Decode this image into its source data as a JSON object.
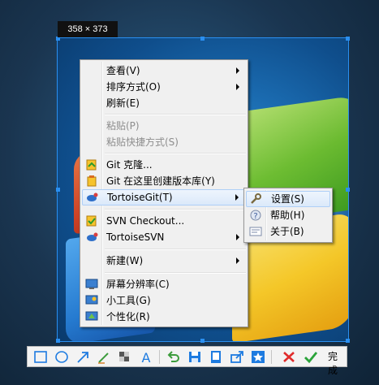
{
  "size_label": "358 × 373",
  "context_menu": {
    "items": [
      {
        "label": "查看(V)",
        "has_submenu": true,
        "enabled": true
      },
      {
        "label": "排序方式(O)",
        "has_submenu": true,
        "enabled": true
      },
      {
        "label": "刷新(E)",
        "has_submenu": false,
        "enabled": true
      },
      {
        "label": "粘贴(P)",
        "has_submenu": false,
        "enabled": false
      },
      {
        "label": "粘贴快捷方式(S)",
        "has_submenu": false,
        "enabled": false
      },
      {
        "label": "Git 克隆...",
        "icon": "git-clone-icon",
        "enabled": true
      },
      {
        "label": "Git 在这里创建版本库(Y)",
        "icon": "git-create-repo-icon",
        "enabled": true
      },
      {
        "label": "TortoiseGit(T)",
        "icon": "tortoisegit-icon",
        "has_submenu": true,
        "enabled": true,
        "highlighted": true
      },
      {
        "label": "SVN Checkout...",
        "icon": "svn-checkout-icon",
        "enabled": true
      },
      {
        "label": "TortoiseSVN",
        "icon": "tortoisesvn-icon",
        "has_submenu": true,
        "enabled": true
      },
      {
        "label": "新建(W)",
        "has_submenu": true,
        "enabled": true
      },
      {
        "label": "屏幕分辨率(C)",
        "icon": "screen-resolution-icon",
        "enabled": true
      },
      {
        "label": "小工具(G)",
        "icon": "gadgets-icon",
        "enabled": true
      },
      {
        "label": "个性化(R)",
        "icon": "personalize-icon",
        "enabled": true
      }
    ]
  },
  "submenu": {
    "items": [
      {
        "label": "设置(S)",
        "icon": "settings-icon",
        "highlighted": true
      },
      {
        "label": "帮助(H)",
        "icon": "help-icon"
      },
      {
        "label": "关于(B)",
        "icon": "about-icon"
      }
    ]
  },
  "toolbar": {
    "tools": [
      "rectangle-icon",
      "ellipse-icon",
      "arrow-icon",
      "pen-icon",
      "mosaic-icon",
      "text-icon",
      "undo-icon",
      "save-icon",
      "pin-icon",
      "share-icon",
      "star-icon",
      "cancel-icon",
      "done-icon"
    ],
    "done_label": "完成",
    "colors": {
      "accent": "#1e7be0",
      "cancel": "#e02b2b",
      "done": "#2aa33a"
    }
  }
}
